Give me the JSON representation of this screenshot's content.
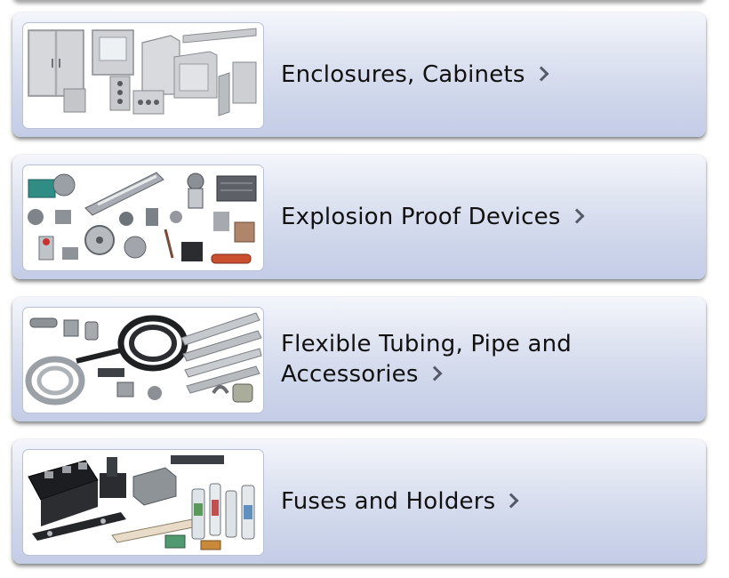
{
  "categories": [
    {
      "label": "Enclosures, Cabinets",
      "image_alt": "enclosures-cabinets-image",
      "icon": "chevron-right-icon"
    },
    {
      "label": "Explosion Proof Devices",
      "image_alt": "explosion-proof-devices-image",
      "icon": "chevron-right-icon"
    },
    {
      "label": "Flexible Tubing, Pipe and Accessories",
      "image_alt": "flexible-tubing-pipe-image",
      "icon": "chevron-right-icon"
    },
    {
      "label": "Fuses and Holders",
      "image_alt": "fuses-holders-image",
      "icon": "chevron-right-icon"
    }
  ],
  "colors": {
    "card_top": "#f4f6fb",
    "card_bottom": "#c4cde6",
    "text": "#111111",
    "chevron": "#555a66"
  }
}
